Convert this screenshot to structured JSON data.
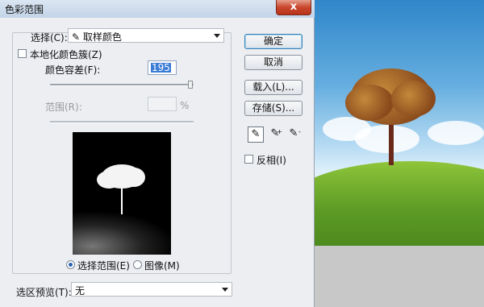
{
  "window": {
    "title": "色彩范围",
    "close_glyph": "x"
  },
  "select_row": {
    "label": "选择(C):",
    "value": "取样颜色",
    "icon": "eyedropper-icon"
  },
  "localized_clusters": {
    "label": "本地化颜色簇(Z)",
    "checked": false
  },
  "fuzziness": {
    "label": "颜色容差(F):",
    "value": "195",
    "slider_fraction": 0.98
  },
  "range": {
    "label": "范围(R):",
    "value": "",
    "unit": "%"
  },
  "view": {
    "selection_label": "选择范围(E)",
    "image_label": "图像(M)",
    "selected": "selection"
  },
  "selection_preview": {
    "label": "选区预览(T):",
    "value": "无"
  },
  "buttons": {
    "ok": "确定",
    "cancel": "取消",
    "load": "载入(L)...",
    "save": "存储(S)..."
  },
  "eyedroppers": [
    "eyedropper-icon",
    "eyedropper-plus-icon",
    "eyedropper-minus-icon"
  ],
  "invert": {
    "label": "反相(I)",
    "checked": false
  },
  "colors": {
    "title_bar": "#c7d8ec",
    "close_button": "#c8462c",
    "selection_highlight": "#3a7bd5"
  }
}
